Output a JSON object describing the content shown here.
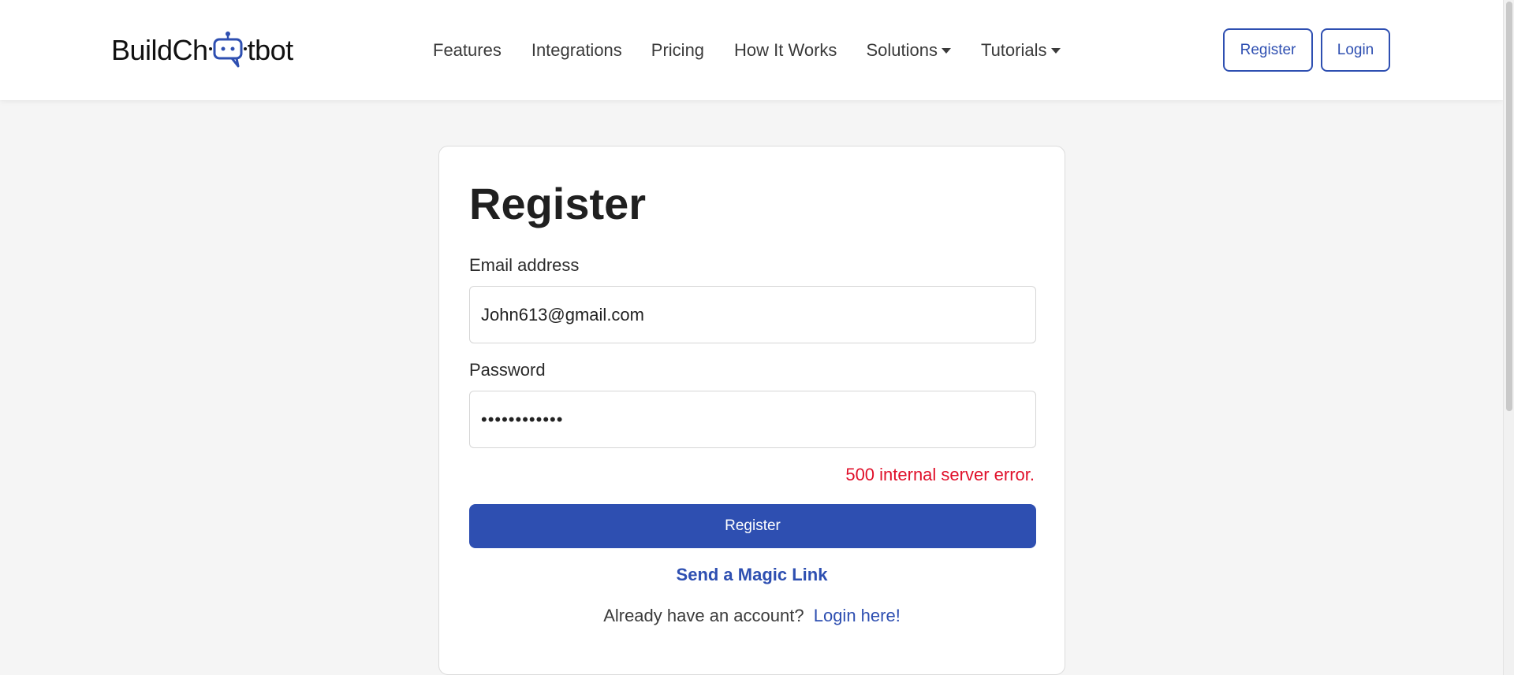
{
  "brand": {
    "logo_text_left": "BuildCh",
    "logo_text_right": "tbot",
    "accent_color": "#2e4fb1",
    "error_color": "#e0102a"
  },
  "nav": {
    "items": [
      {
        "label": "Features"
      },
      {
        "label": "Integrations"
      },
      {
        "label": "Pricing"
      },
      {
        "label": "How It Works"
      },
      {
        "label": "Solutions",
        "dropdown": true
      },
      {
        "label": "Tutorials",
        "dropdown": true
      }
    ]
  },
  "header_buttons": {
    "register": "Register",
    "login": "Login"
  },
  "form": {
    "title": "Register",
    "email_label": "Email address",
    "email_value": "John613@gmail.com",
    "password_label": "Password",
    "password_value": "••••••••••••",
    "error_message": "500 internal server error.",
    "submit_label": "Register",
    "magic_link_label": "Send a Magic Link",
    "login_prompt": "Already have an account?",
    "login_link": "Login here!"
  }
}
